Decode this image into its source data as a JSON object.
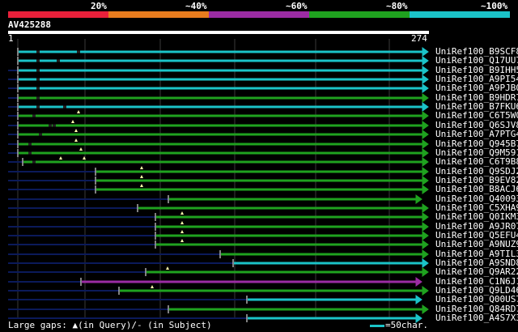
{
  "colors": {
    "red": "#e8203a",
    "orange": "#e87c1e",
    "purple": "#9b2ca3",
    "green": "#1fa21f",
    "cyan": "#1bc3c8",
    "navy": "#0b1a5a",
    "white": "#ffffff",
    "grid": "#3a3a3a",
    "background": "#000000"
  },
  "scale": {
    "labels": [
      "20%",
      "~40%",
      "~60%",
      "~80%",
      "~100%"
    ],
    "band_colors": [
      "red",
      "orange",
      "purple",
      "green",
      "cyan"
    ]
  },
  "query": {
    "name": "AV425288",
    "start": "1",
    "end": "274"
  },
  "hits": [
    {
      "name": "UniRef100_B9SCF8",
      "color": "cyan"
    },
    {
      "name": "UniRef100_Q17UU7",
      "color": "cyan"
    },
    {
      "name": "UniRef100_B9IHH5",
      "color": "cyan"
    },
    {
      "name": "UniRef100_A9PI54",
      "color": "cyan"
    },
    {
      "name": "UniRef100_A9PJB0",
      "color": "cyan"
    },
    {
      "name": "UniRef100_B9HDR7",
      "color": "green"
    },
    {
      "name": "UniRef100_B7FKU6",
      "color": "cyan"
    },
    {
      "name": "UniRef100_C6T5W0",
      "color": "green"
    },
    {
      "name": "UniRef100_Q6SJV8",
      "color": "green"
    },
    {
      "name": "UniRef100_A7PTG4",
      "color": "green"
    },
    {
      "name": "UniRef100_Q945B7",
      "color": "green"
    },
    {
      "name": "UniRef100_Q9M591",
      "color": "green"
    },
    {
      "name": "UniRef100_C6T9B8",
      "color": "green"
    },
    {
      "name": "UniRef100_Q9SDJ2",
      "color": "green"
    },
    {
      "name": "UniRef100_B9EV82",
      "color": "green"
    },
    {
      "name": "UniRef100_B8ACJ6",
      "color": "green"
    },
    {
      "name": "UniRef100_Q40093",
      "color": "green"
    },
    {
      "name": "UniRef100_C5XHA9",
      "color": "green"
    },
    {
      "name": "UniRef100_Q0IKM3",
      "color": "green"
    },
    {
      "name": "UniRef100_A9JR07",
      "color": "green"
    },
    {
      "name": "UniRef100_Q5EFU4",
      "color": "green"
    },
    {
      "name": "UniRef100_A9NUZ9",
      "color": "green"
    },
    {
      "name": "UniRef100_A9TIL3",
      "color": "green"
    },
    {
      "name": "UniRef100_A9SND8",
      "color": "cyan"
    },
    {
      "name": "UniRef100_Q9AR22",
      "color": "green"
    },
    {
      "name": "UniRef100_C1N6J1",
      "color": "purple"
    },
    {
      "name": "UniRef100_Q9LD46",
      "color": "green"
    },
    {
      "name": "UniRef100_Q00US7",
      "color": "cyan"
    },
    {
      "name": "UniRef100_Q84RD7",
      "color": "green"
    },
    {
      "name": "UniRef100_A4S7X3",
      "color": "cyan"
    }
  ],
  "legend": {
    "gaps_text": "Large gaps: ▲(in Query)/- (in Subject)",
    "scale_text": "=50char."
  }
}
